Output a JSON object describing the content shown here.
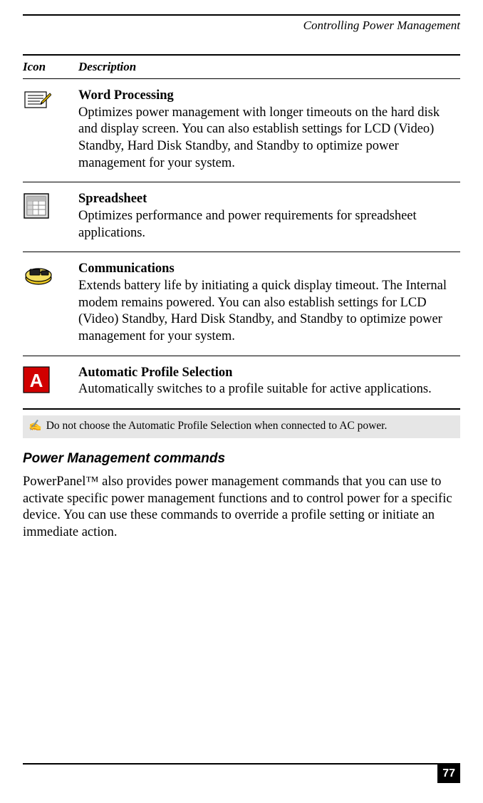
{
  "header": {
    "running_title": "Controlling Power Management"
  },
  "table": {
    "headers": {
      "icon": "Icon",
      "description": "Description"
    },
    "rows": [
      {
        "icon_name": "word-processing-icon",
        "title": "Word Processing",
        "text": "Optimizes power management with longer timeouts on the hard disk and display screen. You can also establish settings for LCD (Video) Standby, Hard Disk Standby, and Standby to optimize power management for your system."
      },
      {
        "icon_name": "spreadsheet-icon",
        "title": "Spreadsheet",
        "text": "Optimizes performance and power requirements for spreadsheet applications."
      },
      {
        "icon_name": "communications-icon",
        "title": "Communications",
        "text": "Extends battery life by initiating a quick display timeout. The Internal modem remains powered. You can also establish settings for LCD (Video) Standby, Hard Disk Standby, and Standby to optimize power management for your system."
      },
      {
        "icon_name": "automatic-profile-icon",
        "title": "Automatic Profile Selection",
        "text": "Automatically switches to a profile suitable for active applications."
      }
    ]
  },
  "note": {
    "symbol": "✍",
    "text": "Do not choose the Automatic Profile Selection when connected to AC power."
  },
  "section": {
    "heading": "Power Management commands",
    "body": "PowerPanel™ also provides power management commands that you can use to activate specific power management functions and to control power for a specific device. You can use these commands to override a profile setting or initiate an immediate action."
  },
  "footer": {
    "page_number": "77"
  }
}
